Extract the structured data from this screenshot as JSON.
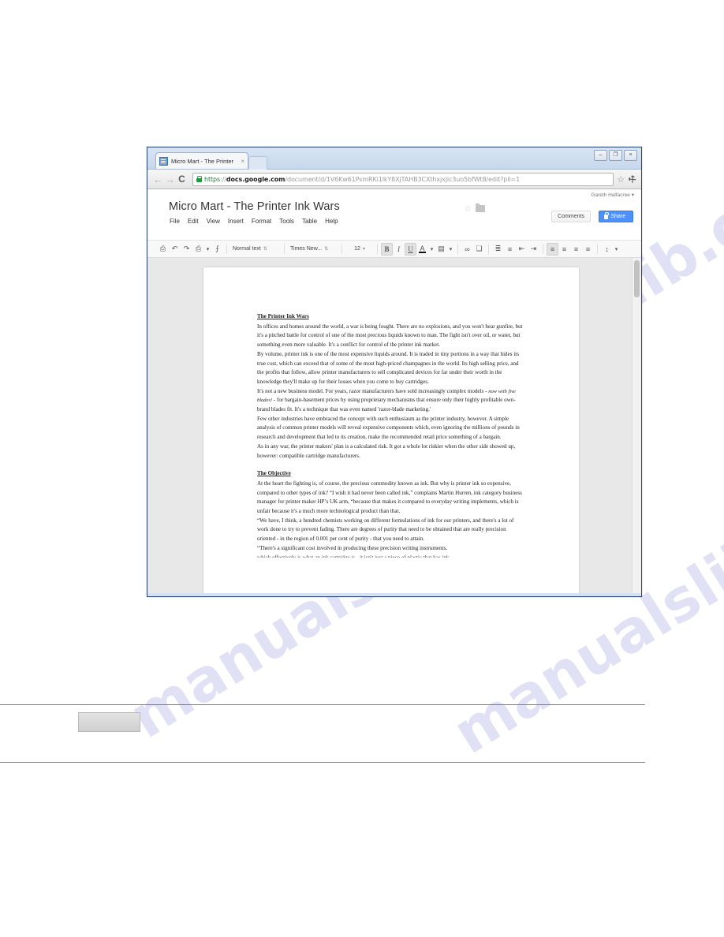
{
  "watermark": {
    "fragments": [
      "manualslib.com",
      "manualslib.com",
      "manualslib.com"
    ]
  },
  "browser": {
    "tab": {
      "title": "Micro Mart - The Printer",
      "close_label": "×",
      "favicon_name": "docs-favicon"
    },
    "window_controls": {
      "minimize": "–",
      "maximize": "❐",
      "close": "×"
    },
    "nav": {
      "back": "←",
      "forward": "→",
      "reload": "C"
    },
    "omnibox": {
      "scheme": "https",
      "separator": "://",
      "host": "docs.google.com",
      "path": "/document/d/1V6Kw61PsmRKi1lkY8XjTAHB3CXthxjxjic3uo5bfWt8/edit?pli=1",
      "full_url": "https://docs.google.com/document/d/1V6Kw61PsmRKi1lkY8XjTAHB3CXthxjxjic3uo5bfWt8/edit?pli=1",
      "bookmark_star": "☆",
      "menu_wrench": "⚒"
    }
  },
  "docs": {
    "account_name": "Gareth Halfacree",
    "account_caret": "▾",
    "document_title": "Micro Mart - The Printer Ink Wars",
    "star_glyph": "☆",
    "menu": [
      "File",
      "Edit",
      "View",
      "Insert",
      "Format",
      "Tools",
      "Table",
      "Help"
    ],
    "comments_label": "Comments",
    "share_label": "Share",
    "toolbar": {
      "print": "⎙",
      "undo": "↶",
      "redo": "↷",
      "paint_format": "⎙",
      "paint_caret": "▾",
      "clear_format": "⨍",
      "paragraph_style": "Normal text",
      "paragraph_caret": "⇅",
      "font_family": "Times New...",
      "font_caret": "⇅",
      "font_size": "12",
      "size_caret": "▾",
      "bold": "B",
      "italic": "I",
      "underline": "U",
      "text_color": "A",
      "text_color_caret": "▾",
      "highlight": "▤",
      "highlight_caret": "▾",
      "link": "∞",
      "image": "❑",
      "numbered_list": "≣",
      "bulleted_list": "≡",
      "decrease_indent": "⇤",
      "increase_indent": "⇥",
      "align_left": "≡",
      "align_center": "≡",
      "align_right": "≡",
      "align_justify": "≡",
      "line_spacing": "↕",
      "line_spacing_caret": "▾"
    }
  },
  "document": {
    "heading1": "The Printer Ink Wars",
    "paragraphs1": [
      "In offices and homes around the world, a war is being fought. There are no explosions, and you won't hear gunfire, but it's a pitched battle for control of one of the most precious liquids known to man. The fight isn't over oil, or water, but something even more valuable. It's a conflict for control of the printer ink market.",
      "By volume, printer ink is one of the most expensive liquids around. It is traded in tiny portions in a way that hides its true cost, which can exceed that of some of the most high-priced champagnes in the world. Its high selling price, and the profits that follow, allow printer manufacturers to sell complicated devices for far under their worth in the knowledge they'll make up for their losses when you come to buy cartridges."
    ],
    "razor_para_pre": "It's not a new business model. For years, razor manufacturers have sold increasingly complex models - ",
    "razor_para_em": "now with five blades!",
    "razor_para_post": " - for bargain-basement prices by using proprietary mechanisms that ensure only their highly profitable own-brand blades fit. It's a technique that was even named 'razor-blade marketing.'",
    "paragraphs2": [
      "Few other industries have embraced the concept with such enthusiasm as the printer industry, however. A simple analysis of common printer models will reveal expensive components which, even ignoring the millions of pounds in research and development that led to its creation, make the recommended retail price something of a bargain.",
      "As in any war, the printer makers' plan is a calculated risk. It got a whole lot riskier when the other side showed up, however: compatible cartridge manufacturers."
    ],
    "heading2": "The Objective",
    "paragraphs3": [
      "At the heart the fighting is, of course, the precious commodity known as ink. But why is printer ink so expensive, compared to other types of ink? “I wish it had never been called ink,” complains Martin Hurren, ink category business manager for printer maker HP’s UK arm, “because that makes it compared to everyday writing implements, which is unfair because it's a much more technological product than that.",
      "“We have, I think, a hundred chemists working on different formulations of ink for our printers, and there's a lot of work done to try to prevent fading. There are degrees of purity that need to be obtained that are really precision oriented - in the region of 0.001 per cent of purity - that you need to attain.",
      "“There's a significant cost involved in producing these precision writing instruments,"
    ],
    "clipped_line": "which effectively is what an ink cartridge is - it isn't just a piece of plastic that has ink"
  }
}
